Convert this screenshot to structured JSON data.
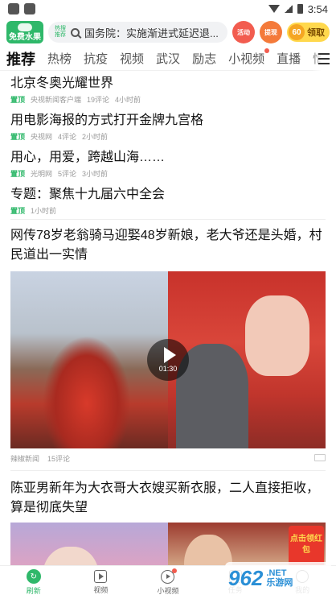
{
  "status": {
    "time": "3:54"
  },
  "header": {
    "logo_text": "免费水果",
    "rec_tag": "热搜推荐",
    "search_text": "国务院：实施渐进式延迟退...",
    "activity_label": "活动",
    "withdraw_label": "提现",
    "coin_value": "60",
    "coin_label": "领取"
  },
  "tabs": [
    {
      "label": "推荐",
      "active": true
    },
    {
      "label": "热榜"
    },
    {
      "label": "抗疫"
    },
    {
      "label": "视频"
    },
    {
      "label": "武汉"
    },
    {
      "label": "励志"
    },
    {
      "label": "小视频",
      "dot": true
    },
    {
      "label": "直播"
    },
    {
      "label": "情感"
    }
  ],
  "news": [
    {
      "title": "北京冬奥光耀世界",
      "tag": "置顶",
      "source": "央视新闻客户端",
      "comments": "19评论",
      "time": "4小时前"
    },
    {
      "title": "用电影海报的方式打开金牌九宫格",
      "tag": "置顶",
      "source": "央视网",
      "comments": "4评论",
      "time": "2小时前"
    },
    {
      "title": "用心，用爱，跨越山海……",
      "tag": "置顶",
      "source": "光明网",
      "comments": "5评论",
      "time": "3小时前"
    },
    {
      "title": "专题：聚焦十九届六中全会",
      "tag": "置顶",
      "source": "",
      "comments": "",
      "time": "1小时前"
    }
  ],
  "feature": {
    "title": "网传78岁老翁骑马迎娶48岁新娘，老大爷还是头婚，村民道出一实情",
    "duration": "01:30",
    "source": "辣椒新闻",
    "comments": "15评论"
  },
  "feature2": {
    "title": "陈亚男新年为大衣哥大衣嫂买新衣服，二人直接拒收，算是彻底失望",
    "redpacket": "点击领红包"
  },
  "bottom_nav": [
    {
      "label": "刷新",
      "icon": "refresh-icon",
      "active": true
    },
    {
      "label": "视频",
      "icon": "video-icon"
    },
    {
      "label": "小视频",
      "icon": "small-video-icon"
    },
    {
      "label": "任务",
      "icon": "task-icon"
    },
    {
      "label": "我的",
      "icon": "profile-icon"
    }
  ],
  "watermark": {
    "big": "962",
    "small1": ".NET",
    "small2": "乐游网"
  }
}
